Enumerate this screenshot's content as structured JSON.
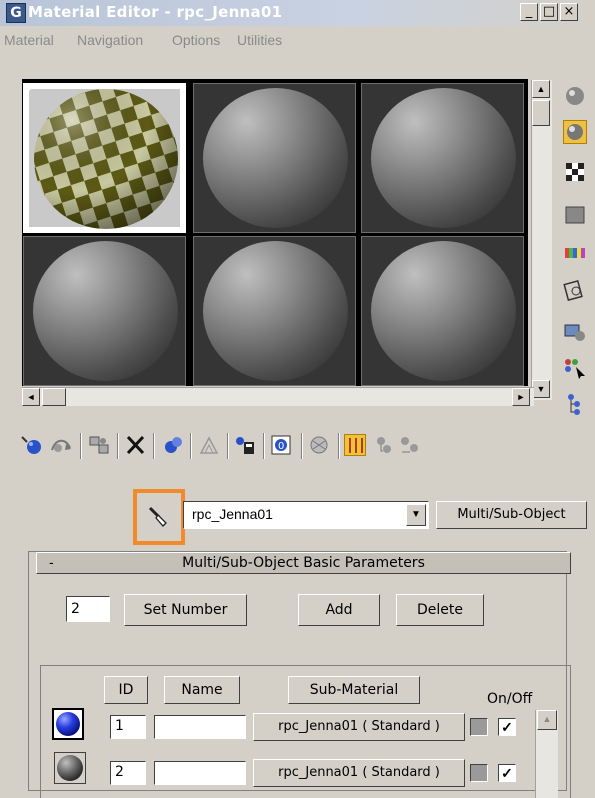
{
  "window": {
    "title": "Material Editor - rpc_Jenna01",
    "minimize": "_",
    "maximize": "□",
    "close": "×"
  },
  "menu": [
    "Material",
    "Navigation",
    "Options",
    "Utilities"
  ],
  "scroll": {
    "up": "▲",
    "down": "▼",
    "left": "◄",
    "right": "►"
  },
  "toolbar": {
    "icons": [
      "get-material-icon",
      "put-to-scene-icon",
      "assign-to-selection-icon",
      "reset-map-icon",
      "make-copy-icon",
      "make-unique-icon",
      "put-to-library-icon",
      "material-id-channel-icon",
      "show-map-in-viewport-icon",
      "show-end-result-icon",
      "go-to-parent-icon",
      "go-forward-to-sibling-icon"
    ],
    "pick_icon": "pick-material-from-object-icon"
  },
  "material": {
    "name": "rpc_Jenna01",
    "type_button": "Multi/Sub-Object",
    "dropdown_arrow": "▼"
  },
  "rollout": {
    "collapse": "-",
    "title": "Multi/Sub-Object Basic Parameters",
    "number_value": "2",
    "set_number": "Set Number",
    "add": "Add",
    "delete": "Delete"
  },
  "table": {
    "headers": {
      "id": "ID",
      "name": "Name",
      "sub_material": "Sub-Material",
      "on_off": "On/Off"
    },
    "rows": [
      {
        "id": "1",
        "name": "",
        "sub_material": "rpc_Jenna01  ( Standard )",
        "on": "✓",
        "swatch": "#2a3ee0"
      },
      {
        "id": "2",
        "name": "",
        "sub_material": "rpc_Jenna01  ( Standard )",
        "on": "✓",
        "swatch": "#6a6a6a"
      }
    ]
  },
  "colors": {
    "highlight": "#f08a2b",
    "checker_a": "#c9c9a0",
    "checker_b": "#5c5a14",
    "slot_bg": "#353535"
  }
}
